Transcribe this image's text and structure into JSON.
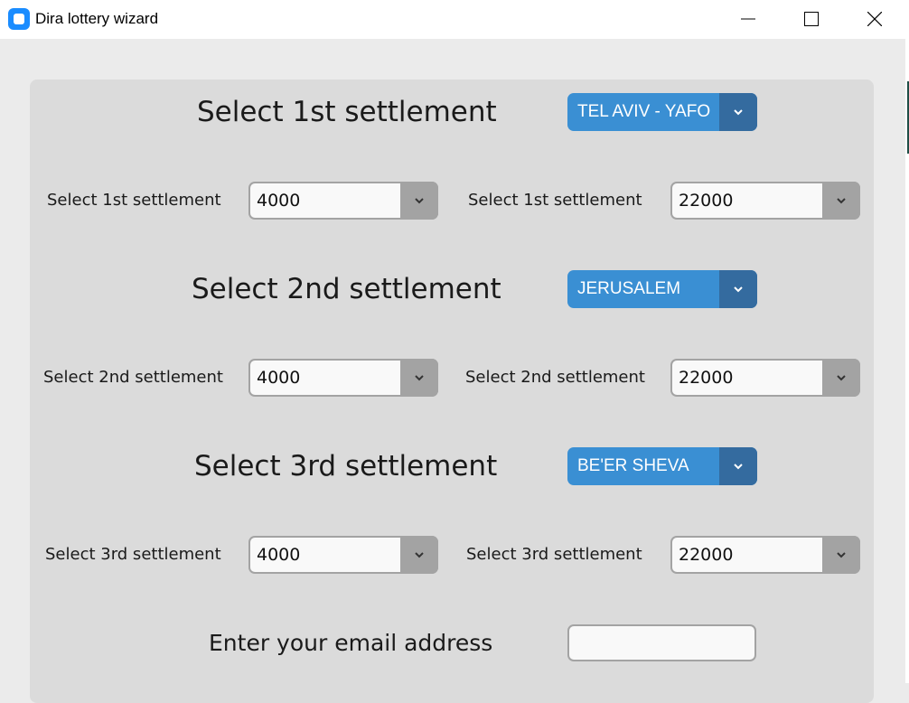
{
  "window": {
    "title": "Dira lottery wizard",
    "minimize_icon": "minimize-icon",
    "maximize_icon": "maximize-icon",
    "close_icon": "close-icon"
  },
  "sections": [
    {
      "heading": "Select 1st settlement",
      "city": "TEL AVIV - YAFO",
      "left_label": "Select 1st settlement",
      "left_value": "4000",
      "right_label": "Select 1st settlement",
      "right_value": "22000"
    },
    {
      "heading": "Select 2nd settlement",
      "city": "JERUSALEM",
      "left_label": "Select 2nd settlement",
      "left_value": "4000",
      "right_label": "Select 2nd settlement",
      "right_value": "22000"
    },
    {
      "heading": "Select 3rd settlement",
      "city": "BE'ER SHEVA",
      "left_label": "Select 3rd settlement",
      "left_value": "4000",
      "right_label": "Select 3rd settlement",
      "right_value": "22000"
    }
  ],
  "email": {
    "label": "Enter your email address",
    "value": ""
  },
  "colors": {
    "accent": "#3a8fd3",
    "accent_dark": "#346b9f",
    "panel": "#dbdbdb",
    "background": "#ebebeb"
  }
}
